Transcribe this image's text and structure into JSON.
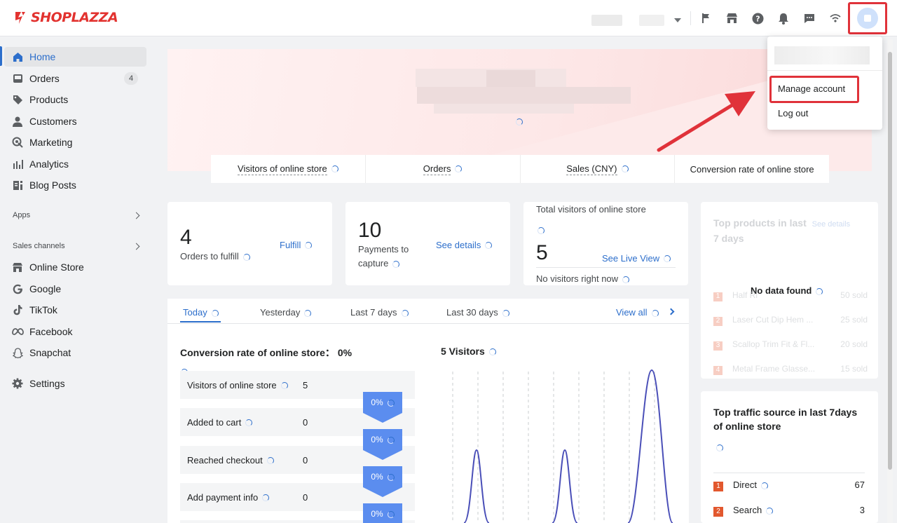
{
  "brand": {
    "name": "SHOPLAZZA",
    "color": "#e2322f"
  },
  "header": {
    "icons": [
      "flag-icon",
      "store-icon",
      "help-icon",
      "bell-icon",
      "chat-icon",
      "wifi-icon"
    ]
  },
  "account_menu": {
    "manage": "Manage account",
    "logout": "Log out"
  },
  "sidebar": {
    "items": [
      {
        "label": "Home",
        "icon": "home-icon"
      },
      {
        "label": "Orders",
        "icon": "orders-icon",
        "badge": "4"
      },
      {
        "label": "Products",
        "icon": "tag-icon"
      },
      {
        "label": "Customers",
        "icon": "person-icon"
      },
      {
        "label": "Marketing",
        "icon": "marketing-icon"
      },
      {
        "label": "Analytics",
        "icon": "analytics-icon"
      },
      {
        "label": "Blog Posts",
        "icon": "blog-icon"
      }
    ],
    "apps_label": "Apps",
    "sales_channels_label": "Sales channels",
    "channels": [
      {
        "label": "Online Store",
        "icon": "store-icon"
      },
      {
        "label": "Google",
        "icon": "google-icon"
      },
      {
        "label": "TikTok",
        "icon": "tiktok-icon"
      },
      {
        "label": "Facebook",
        "icon": "meta-icon"
      },
      {
        "label": "Snapchat",
        "icon": "snapchat-icon"
      }
    ],
    "settings_label": "Settings"
  },
  "stats_bar": [
    "Visitors of online store",
    "Orders",
    "Sales (CNY)",
    "Conversion rate of online store"
  ],
  "cards": {
    "orders": {
      "value": "4",
      "label": "Orders to fulfill",
      "link": "Fulfill"
    },
    "payments": {
      "value": "10",
      "label_1": "Payments to",
      "label_2": "capture",
      "link": "See details"
    },
    "visitors": {
      "title": "Total visitors of online store",
      "value": "5",
      "link": "See Live View",
      "note": "No visitors right now"
    }
  },
  "tabs": {
    "items": [
      "Today",
      "Yesterday",
      "Last 7 days",
      "Last 30 days"
    ],
    "view_all": "View all"
  },
  "conversion": {
    "title": "Conversion rate of online store： 0%",
    "rows": [
      {
        "name": "Visitors of online store",
        "value": "5"
      },
      {
        "name": "Added to cart",
        "value": "0"
      },
      {
        "name": "Reached checkout",
        "value": "0"
      },
      {
        "name": "Add payment info",
        "value": "0"
      }
    ],
    "rates": [
      "0%",
      "0%",
      "0%",
      "0%"
    ]
  },
  "visitors_chart": {
    "title": "5 Visitors"
  },
  "top_products": {
    "title_1": "Top products in last",
    "title_2": "7 days",
    "link": "See details",
    "empty": "No data found",
    "items": [
      {
        "rank": "1",
        "name": "Half Ri",
        "sold": "50 sold"
      },
      {
        "rank": "2",
        "name": "Laser Cut Dip Hem ...",
        "sold": "25 sold"
      },
      {
        "rank": "3",
        "name": "Scallop Trim Fit & Fl...",
        "sold": "20 sold"
      },
      {
        "rank": "4",
        "name": "Metal Frame Glasse...",
        "sold": "15 sold"
      }
    ]
  },
  "traffic": {
    "title_1": "Top traffic source in last 7days",
    "title_2": "of online store",
    "items": [
      {
        "rank": "1",
        "name": "Direct",
        "value": "67"
      },
      {
        "rank": "2",
        "name": "Search",
        "value": "3"
      }
    ]
  },
  "colors": {
    "accent": "#2c6ecb",
    "highlight": "#e0323a",
    "funnel": "#5b8def",
    "rank": "#e2582e"
  }
}
